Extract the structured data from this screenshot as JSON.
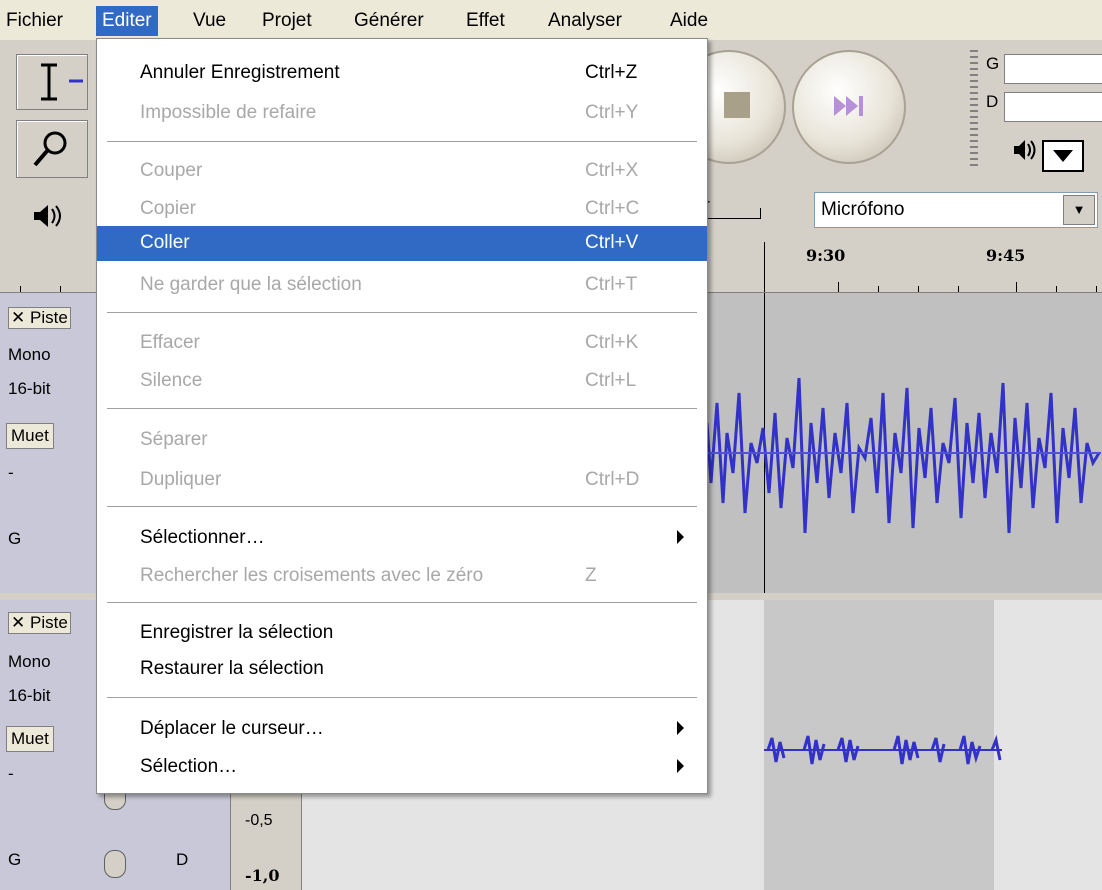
{
  "menubar": {
    "items": [
      "Fichier",
      "Editer",
      "Vue",
      "Projet",
      "Générer",
      "Effet",
      "Analyser",
      "Aide"
    ],
    "active_index": 1
  },
  "colors": {
    "menu_highlight": "#316ac5",
    "waveform": "#3232c8",
    "track_bg": "#c8c8d8"
  },
  "toolbar": {
    "meter_labels": [
      "G",
      "D"
    ],
    "input_source": "Micrófono",
    "plus_sign": "+"
  },
  "ruler": {
    "labels": [
      "9:30",
      "9:45"
    ]
  },
  "tracks": [
    {
      "name": "Piste",
      "close": "✕",
      "format": "Mono",
      "bits": "16-bit",
      "mute": "Muet",
      "minus": "-",
      "pan_left": "G"
    },
    {
      "name": "Piste",
      "close": "✕",
      "format": "Mono",
      "bits": "16-bit",
      "mute": "Muet",
      "minus": "-",
      "pan_left": "G",
      "pan_right": "D",
      "scale": [
        "-0,5",
        "-1,0"
      ]
    }
  ],
  "edit_menu": {
    "items": [
      {
        "label": "Annuler Enregistrement",
        "shortcut": "Ctrl+Z",
        "enabled": true
      },
      {
        "label": "Impossible de refaire",
        "shortcut": "Ctrl+Y",
        "enabled": false
      },
      {
        "label": "Couper",
        "shortcut": "Ctrl+X",
        "enabled": false
      },
      {
        "label": "Copier",
        "shortcut": "Ctrl+C",
        "enabled": false
      },
      {
        "label": "Coller",
        "shortcut": "Ctrl+V",
        "enabled": true,
        "selected": true
      },
      {
        "label": "Ne garder que la sélection",
        "shortcut": "Ctrl+T",
        "enabled": false
      },
      {
        "label": "Effacer",
        "shortcut": "Ctrl+K",
        "enabled": false
      },
      {
        "label": "Silence",
        "shortcut": "Ctrl+L",
        "enabled": false
      },
      {
        "label": "Séparer",
        "shortcut": "",
        "enabled": false
      },
      {
        "label": "Dupliquer",
        "shortcut": "Ctrl+D",
        "enabled": false
      },
      {
        "label": "Sélectionner…",
        "shortcut": "",
        "enabled": true,
        "submenu": true
      },
      {
        "label": "Rechercher les croisements avec le zéro",
        "shortcut": "Z",
        "enabled": false
      },
      {
        "label": "Enregistrer la sélection",
        "shortcut": "",
        "enabled": true
      },
      {
        "label": "Restaurer la sélection",
        "shortcut": "",
        "enabled": true
      },
      {
        "label": "Déplacer le curseur…",
        "shortcut": "",
        "enabled": true,
        "submenu": true
      },
      {
        "label": "Sélection…",
        "shortcut": "",
        "enabled": true,
        "submenu": true
      }
    ]
  }
}
